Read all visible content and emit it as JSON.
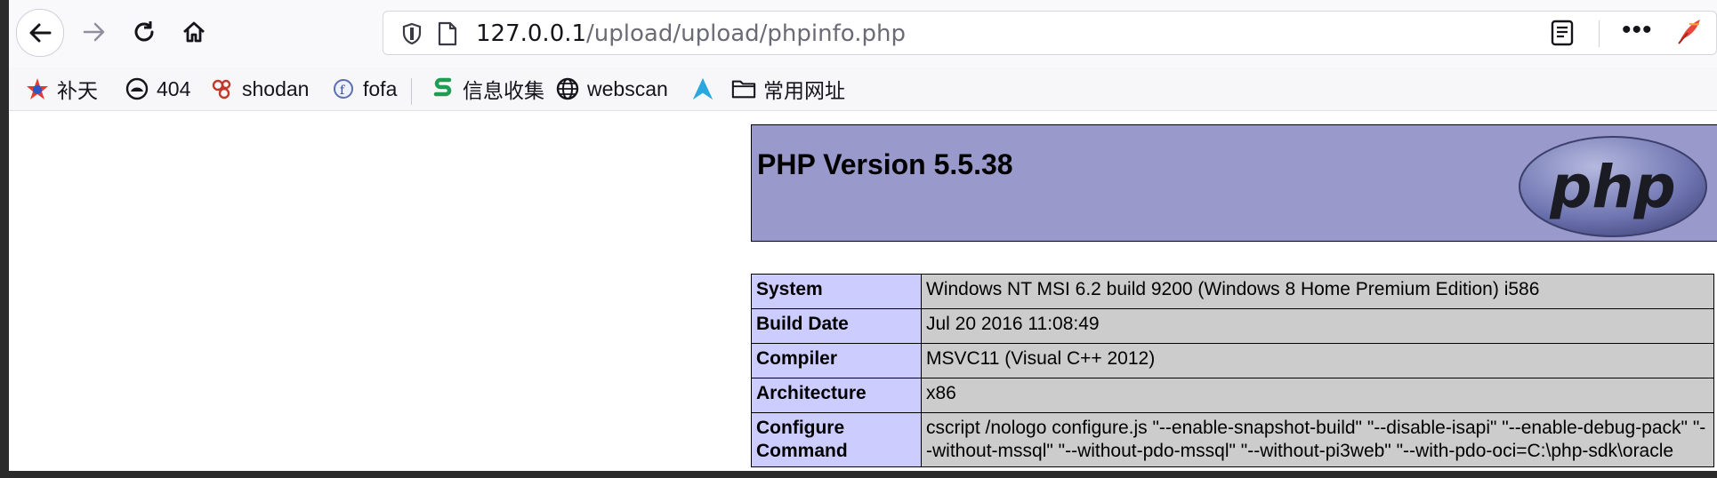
{
  "browser": {
    "url_host": "127.0.0.1",
    "url_path": "/upload/upload/phpinfo.php",
    "icons": [
      "back-icon",
      "forward-icon",
      "reload-icon",
      "home-icon",
      "shield-icon",
      "page-icon",
      "reader-icon",
      "more-icon",
      "quill-icon"
    ],
    "bookmarks": [
      {
        "label": "补天",
        "icon": "star-icon"
      },
      {
        "label": "404",
        "icon": "helmet-icon"
      },
      {
        "label": "shodan",
        "icon": "shodan-icon"
      },
      {
        "label": "fofa",
        "icon": "fofa-icon"
      },
      {
        "label": "信息收集",
        "icon": "s-icon"
      },
      {
        "label": "webscan",
        "icon": "globe-icon"
      },
      {
        "label": "",
        "icon": "a-logo-icon"
      },
      {
        "label": "常用网址",
        "icon": "folder-icon"
      }
    ]
  },
  "phpinfo": {
    "title": "PHP Version 5.5.38",
    "logo_text": "php",
    "rows": [
      {
        "key": "System",
        "value": "Windows NT MSI 6.2 build 9200 (Windows 8 Home Premium Edition) i586"
      },
      {
        "key": "Build Date",
        "value": "Jul 20 2016 11:08:49"
      },
      {
        "key": "Compiler",
        "value": "MSVC11 (Visual C++ 2012)"
      },
      {
        "key": "Architecture",
        "value": "x86"
      },
      {
        "key": "Configure Command",
        "value": "cscript /nologo configure.js \"--enable-snapshot-build\" \"--disable-isapi\" \"--enable-debug-pack\" \"--without-mssql\" \"--without-pdo-mssql\" \"--without-pi3web\" \"--with-pdo-oci=C:\\php-sdk\\oracle"
      }
    ]
  },
  "colors": {
    "php_header": "#9999cc",
    "key_cell": "#ccccff",
    "value_cell": "#cccccc"
  }
}
